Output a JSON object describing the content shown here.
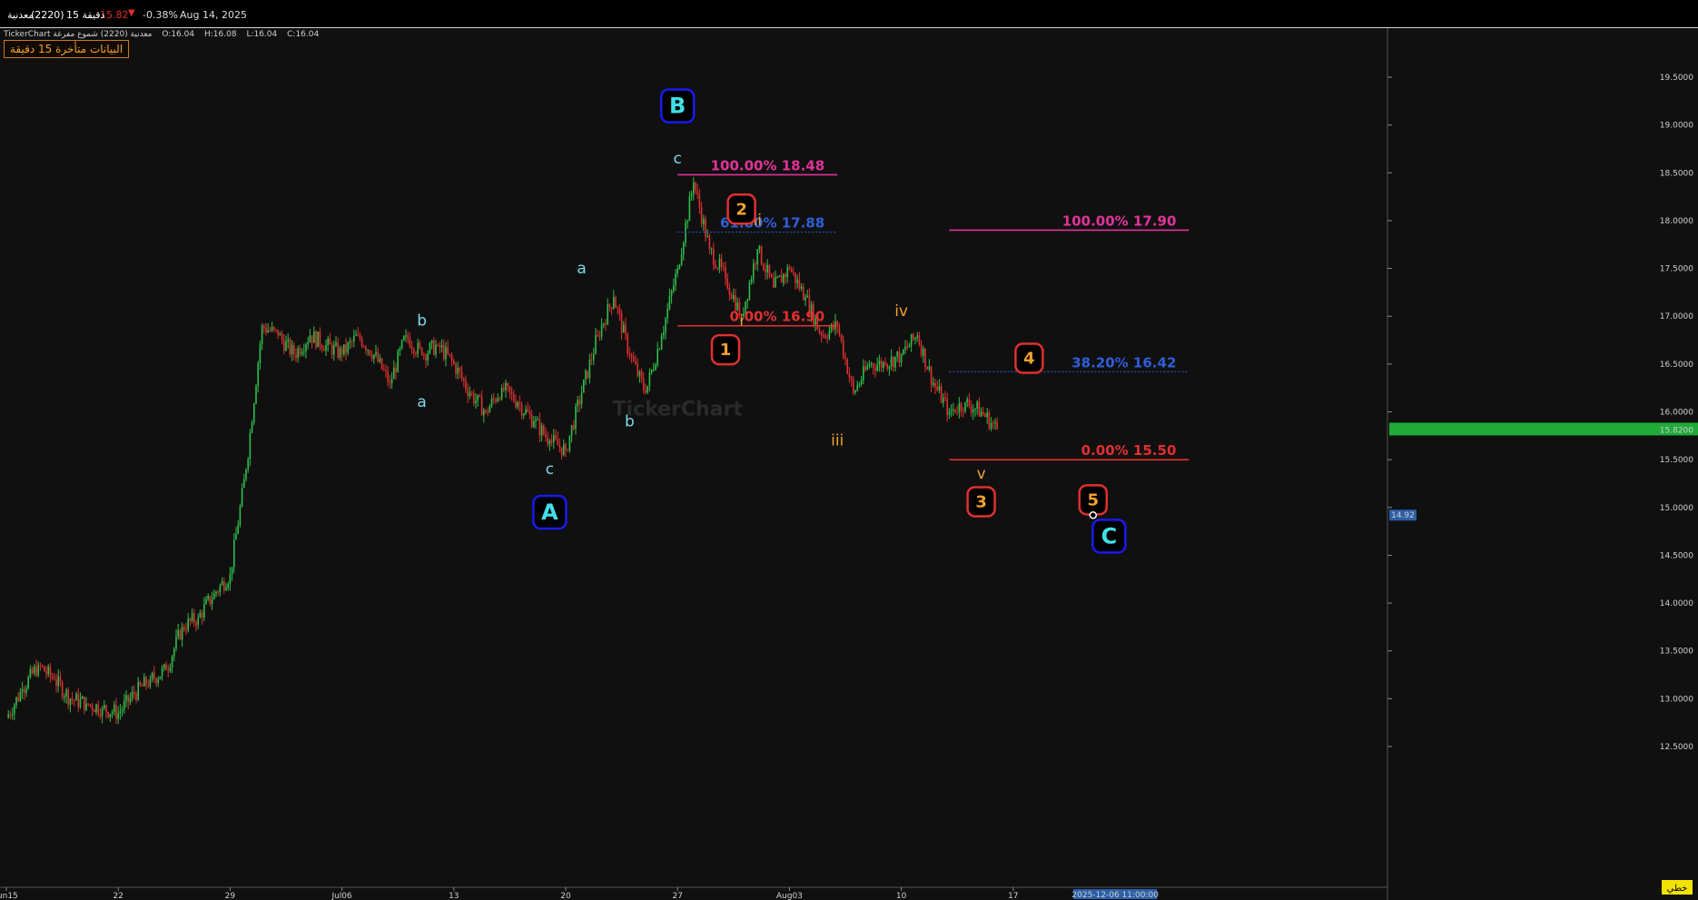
{
  "header": {
    "symbol_name": "معدنية",
    "symbol_code": "(2220)",
    "interval": "15 دقيقة",
    "last_price": "15.82",
    "change_pct": "-0.38%",
    "date": "Aug 14, 2025"
  },
  "info_line": {
    "chart_type": "TickerChart معدنية (2220) شموع مفرغة",
    "open": "O:16.04",
    "high": "H:16.08",
    "low": "L:16.04",
    "close": "C:16.04"
  },
  "delay_notice": "البيانات متأخرة 15 دقيقة",
  "watermark": "TickerChart",
  "scale_mode": "خطي",
  "crosshair_time": "2025-12-06 11:00:00",
  "colors": {
    "up": "#2fbf4a",
    "down": "#e03030",
    "price_tag": "#1faa3a",
    "fib_magenta": "#e0339a",
    "fib_blue": "#2f5fd8",
    "fib_red": "#e03030",
    "wave_cyan": "#7fd8ee",
    "wave_orange": "#f0a030",
    "marker_blue": "#1a1af0",
    "marker_red": "#e03030"
  },
  "chart_data": {
    "type": "candlestick",
    "price_axis": {
      "ticks": [
        19.5,
        19.0,
        18.5,
        18.0,
        17.5,
        17.0,
        16.5,
        16.0,
        15.5,
        15.0,
        14.5,
        14.0,
        13.5,
        13.0,
        12.5
      ],
      "tick_labels": [
        "19.5000",
        "19.0000",
        "18.5000",
        "18.0000",
        "17.5000",
        "17.0000",
        "16.5000",
        "16.0000",
        "15.5000",
        "15.0000",
        "14.5000",
        "14.0000",
        "13.5000",
        "13.0000",
        "12.5000"
      ],
      "last_price_tag": {
        "price": 15.82,
        "label": "15.8200"
      },
      "cursor_tag": {
        "price": 14.92,
        "label": "14.92"
      }
    },
    "time_axis": {
      "labels": [
        "Jun15",
        "22",
        "29",
        "Jul06",
        "13",
        "20",
        "27",
        "Aug03",
        "10",
        "17"
      ],
      "dates": [
        "2025-06-15",
        "2025-06-22",
        "2025-06-29",
        "2025-07-06",
        "2025-07-13",
        "2025-07-20",
        "2025-07-27",
        "2025-08-03",
        "2025-08-10",
        "2025-08-17"
      ]
    },
    "price_path": [
      [
        "2025-06-15",
        12.8
      ],
      [
        "2025-06-16",
        13.1
      ],
      [
        "2025-06-17",
        13.35
      ],
      [
        "2025-06-18",
        13.2
      ],
      [
        "2025-06-19",
        13.0
      ],
      [
        "2025-06-20",
        12.95
      ],
      [
        "2025-06-21",
        12.9
      ],
      [
        "2025-06-22",
        12.85
      ],
      [
        "2025-06-23",
        13.05
      ],
      [
        "2025-06-24",
        13.2
      ],
      [
        "2025-06-25",
        13.3
      ],
      [
        "2025-06-26",
        13.75
      ],
      [
        "2025-06-27",
        13.85
      ],
      [
        "2025-06-28",
        14.1
      ],
      [
        "2025-06-29",
        14.3
      ],
      [
        "2025-06-30",
        15.4
      ],
      [
        "2025-07-01",
        16.9
      ],
      [
        "2025-07-02",
        16.8
      ],
      [
        "2025-07-03",
        16.6
      ],
      [
        "2025-07-04",
        16.8
      ],
      [
        "2025-07-05",
        16.7
      ],
      [
        "2025-07-06",
        16.6
      ],
      [
        "2025-07-07",
        16.8
      ],
      [
        "2025-07-08",
        16.6
      ],
      [
        "2025-07-09",
        16.3
      ],
      [
        "2025-07-10",
        16.8
      ],
      [
        "2025-07-11",
        16.6
      ],
      [
        "2025-07-12",
        16.7
      ],
      [
        "2025-07-13",
        16.5
      ],
      [
        "2025-07-14",
        16.2
      ],
      [
        "2025-07-15",
        16.0
      ],
      [
        "2025-07-16",
        16.25
      ],
      [
        "2025-07-17",
        16.1
      ],
      [
        "2025-07-18",
        15.9
      ],
      [
        "2025-07-19",
        15.7
      ],
      [
        "2025-07-20",
        15.6
      ],
      [
        "2025-07-21",
        16.2
      ],
      [
        "2025-07-22",
        16.8
      ],
      [
        "2025-07-23",
        17.2
      ],
      [
        "2025-07-24",
        16.6
      ],
      [
        "2025-07-25",
        16.2
      ],
      [
        "2025-07-26",
        16.8
      ],
      [
        "2025-07-27",
        17.5
      ],
      [
        "2025-07-28",
        18.4
      ],
      [
        "2025-07-29",
        17.7
      ],
      [
        "2025-07-30",
        17.4
      ],
      [
        "2025-07-31",
        17.0
      ],
      [
        "2025-08-01",
        17.7
      ],
      [
        "2025-08-02",
        17.3
      ],
      [
        "2025-08-03",
        17.5
      ],
      [
        "2025-08-04",
        17.2
      ],
      [
        "2025-08-05",
        16.8
      ],
      [
        "2025-08-06",
        16.9
      ],
      [
        "2025-08-07",
        16.2
      ],
      [
        "2025-08-08",
        16.5
      ],
      [
        "2025-08-09",
        16.5
      ],
      [
        "2025-08-10",
        16.6
      ],
      [
        "2025-08-11",
        16.8
      ],
      [
        "2025-08-12",
        16.3
      ],
      [
        "2025-08-13",
        16.0
      ],
      [
        "2025-08-14",
        16.1
      ],
      [
        "2025-08-15",
        16.0
      ],
      [
        "2025-08-16",
        15.82
      ]
    ],
    "fib_levels": [
      {
        "label": "100.00%  18.48",
        "price": 18.48,
        "from": "2025-07-27",
        "to": "2025-08-06",
        "color": "#e0339a",
        "style": "solid"
      },
      {
        "label": "61.80%  17.88",
        "price": 17.88,
        "from": "2025-07-27",
        "to": "2025-08-06",
        "color": "#2f5fd8",
        "style": "dotted"
      },
      {
        "label": "0.00%  16.90",
        "price": 16.9,
        "from": "2025-07-27",
        "to": "2025-08-06",
        "color": "#e03030",
        "style": "solid"
      },
      {
        "label": "100.00%  17.90",
        "price": 17.9,
        "from": "2025-08-13",
        "to": "2025-08-28",
        "color": "#e0339a",
        "style": "solid"
      },
      {
        "label": "38.20%  16.42",
        "price": 16.42,
        "from": "2025-08-13",
        "to": "2025-08-28",
        "color": "#2f5fd8",
        "style": "dotted"
      },
      {
        "label": "0.00%  15.50",
        "price": 15.5,
        "from": "2025-08-13",
        "to": "2025-08-28",
        "color": "#e03030",
        "style": "solid"
      }
    ],
    "wave_labels": [
      {
        "text": "a",
        "date": "2025-07-11",
        "price": 16.05,
        "color": "#7fd8ee"
      },
      {
        "text": "b",
        "date": "2025-07-11",
        "price": 16.9,
        "color": "#7fd8ee"
      },
      {
        "text": "c",
        "date": "2025-07-19",
        "price": 15.35,
        "color": "#7fd8ee"
      },
      {
        "text": "a",
        "date": "2025-07-21",
        "price": 17.45,
        "color": "#7fd8ee"
      },
      {
        "text": "b",
        "date": "2025-07-24",
        "price": 15.85,
        "color": "#7fd8ee"
      },
      {
        "text": "c",
        "date": "2025-07-27",
        "price": 18.6,
        "color": "#7fd8ee"
      },
      {
        "text": "i",
        "date": "2025-07-31",
        "price": 16.9,
        "color": "#f0a030"
      },
      {
        "text": "ii",
        "date": "2025-08-01",
        "price": 17.95,
        "color": "#f0a030"
      },
      {
        "text": "iii",
        "date": "2025-08-06",
        "price": 15.65,
        "color": "#f0a030"
      },
      {
        "text": "iv",
        "date": "2025-08-10",
        "price": 17.0,
        "color": "#f0a030"
      },
      {
        "text": "v",
        "date": "2025-08-15",
        "price": 15.3,
        "color": "#f0a030"
      }
    ],
    "wave_markers": [
      {
        "text": "A",
        "date": "2025-07-19",
        "price": 14.95,
        "border": "#1a1af0",
        "fill_text": "#40e0e8",
        "big": true
      },
      {
        "text": "B",
        "date": "2025-07-27",
        "price": 19.2,
        "border": "#1a1af0",
        "fill_text": "#40e0e8",
        "big": true
      },
      {
        "text": "C",
        "date": "2025-08-23",
        "price": 14.7,
        "border": "#1a1af0",
        "fill_text": "#40e0e8",
        "big": true
      },
      {
        "text": "1",
        "date": "2025-07-30",
        "price": 16.65,
        "border": "#e03030",
        "fill_text": "#f0a030",
        "big": false
      },
      {
        "text": "2",
        "date": "2025-07-31",
        "price": 18.12,
        "border": "#e03030",
        "fill_text": "#f0a030",
        "big": false
      },
      {
        "text": "3",
        "date": "2025-08-15",
        "price": 15.06,
        "border": "#e03030",
        "fill_text": "#f0a030",
        "big": false
      },
      {
        "text": "4",
        "date": "2025-08-18",
        "price": 16.56,
        "border": "#e03030",
        "fill_text": "#f0a030",
        "big": false
      },
      {
        "text": "5",
        "date": "2025-08-22",
        "price": 15.08,
        "border": "#e03030",
        "fill_text": "#f0a030",
        "big": false
      }
    ]
  }
}
